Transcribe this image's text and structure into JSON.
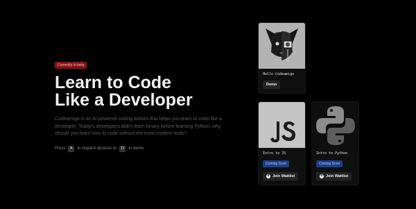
{
  "hero": {
    "badge": "Currently in beta",
    "title_line1": "Learn to Code",
    "title_line2": "Like a Developer",
    "description": "Codeamigo is an AI powered coding asitant that helps you learn to code like a developer. Today's developers didn't learn binary before learning Python, why should you learn how to code without the most modern tools?",
    "shortcut_press": "Press",
    "shortcut_key_a": "A",
    "shortcut_a_text": "to request accesss or",
    "shortcut_key_d": "D",
    "shortcut_d_text": "to demo."
  },
  "cards": [
    {
      "title": "Hello Codeamigo",
      "button": "Demo",
      "image": "robot-dog-icon"
    },
    {
      "title": "Intro to JS",
      "tag": "Coming Soon",
      "button": "Join Waitlist",
      "image": "js-logo-icon"
    },
    {
      "title": "Intro to Python",
      "tag": "Coming Soon",
      "button": "Join Waitlist",
      "image": "python-logo-icon"
    }
  ],
  "colors": {
    "background": "#000000",
    "badge": "#8c1212",
    "coming_soon": "#1c3e8a"
  }
}
